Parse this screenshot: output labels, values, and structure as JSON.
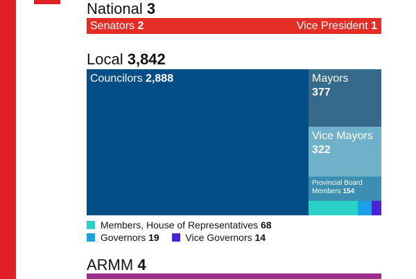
{
  "national": {
    "label": "National",
    "total": "3",
    "senators_label": "Senators",
    "senators_value": "2",
    "vp_label": "Vice President",
    "vp_value": "1"
  },
  "local": {
    "label": "Local",
    "total": "3,842"
  },
  "armm": {
    "label": "ARMM",
    "total": "4"
  },
  "colors": {
    "red": "#e21f26",
    "councilors": "#034e86",
    "mayors": "#356a8a",
    "vice_mayors": "#6fb1c8",
    "provincial_board": "#3c8fb1",
    "house_reps": "#2ad1c6",
    "governors": "#1ca0e6",
    "vice_governors": "#4a23d6",
    "armm": "#9b2f8a"
  },
  "chart_data": {
    "type": "treemap",
    "series": [
      {
        "name": "Councilors",
        "value": 2888,
        "display": "2,888"
      },
      {
        "name": "Mayors",
        "value": 377,
        "display": "377"
      },
      {
        "name": "Vice Mayors",
        "value": 322,
        "display": "322"
      },
      {
        "name": "Provincial Board Members",
        "value": 154,
        "display": "154"
      },
      {
        "name": "Members, House of Representatives",
        "value": 68,
        "display": "68"
      },
      {
        "name": "Governors",
        "value": 19,
        "display": "19"
      },
      {
        "name": "Vice Governors",
        "value": 14,
        "display": "14"
      }
    ],
    "labels": {
      "councilors": "Councilors",
      "mayors": "Mayors",
      "vice_mayors": "Vice Mayors",
      "pbm_line1": "Provincial Board",
      "pbm_line2": "Members"
    }
  },
  "legend": [
    {
      "label": "Members, House of Representatives",
      "value": "68"
    },
    {
      "label": "Governors",
      "value": "19"
    },
    {
      "label": "Vice Governors",
      "value": "14"
    }
  ]
}
